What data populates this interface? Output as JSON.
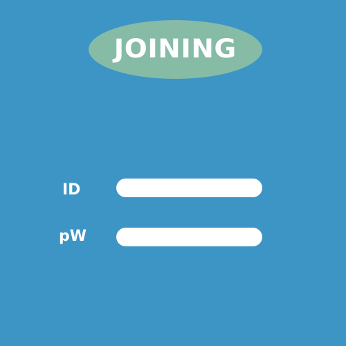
{
  "header": {
    "title": "JOINING"
  },
  "form": {
    "id_label": "ID",
    "id_value": "",
    "pw_label": "pW",
    "pw_value": ""
  },
  "colors": {
    "background": "#3d95c5",
    "title_pill": "#86bba6",
    "text": "#ffffff",
    "input_background": "#ffffff"
  }
}
